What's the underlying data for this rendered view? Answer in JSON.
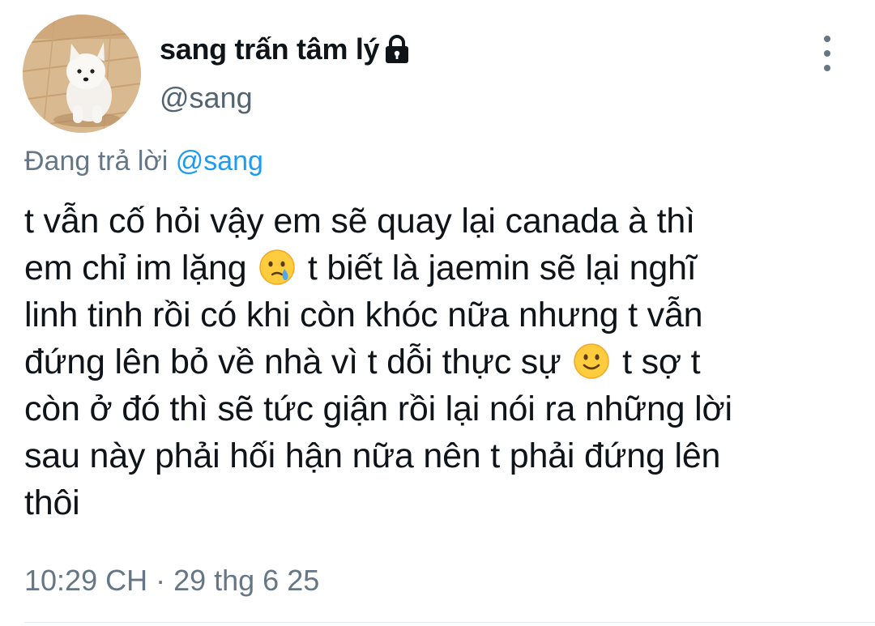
{
  "author": {
    "display_name": "sang trấn tâm lý",
    "handle": "@sang",
    "avatar": "white-puppy-photo",
    "protected_icon": "lock-icon"
  },
  "menu": {
    "icon": "more-vertical-icon"
  },
  "reply": {
    "prefix": "Đang trả lời",
    "mention": "@sang"
  },
  "tweet": {
    "line1": "t vẫn cố hỏi vậy em sẽ quay lại canada à thì",
    "line2a": "em chỉ im lặng",
    "line2b": "t biết là jaemin sẽ lại nghĩ",
    "line3": "linh tinh rồi có khi còn khóc nữa nhưng t vẫn",
    "line4a": "đứng lên bỏ về nhà vì t dỗi thực sự",
    "line4b": "t sợ t",
    "line5": "còn ở đó thì sẽ tức giận rồi lại nói ra những lời",
    "line6": "sau này phải hối hận nữa nên t phải đứng lên",
    "line7": "thôi",
    "emoji1": "crying-face-emoji",
    "emoji2": "slightly-smiling-face-emoji"
  },
  "timestamp": "10:29 CH · 29 thg 6 25"
}
